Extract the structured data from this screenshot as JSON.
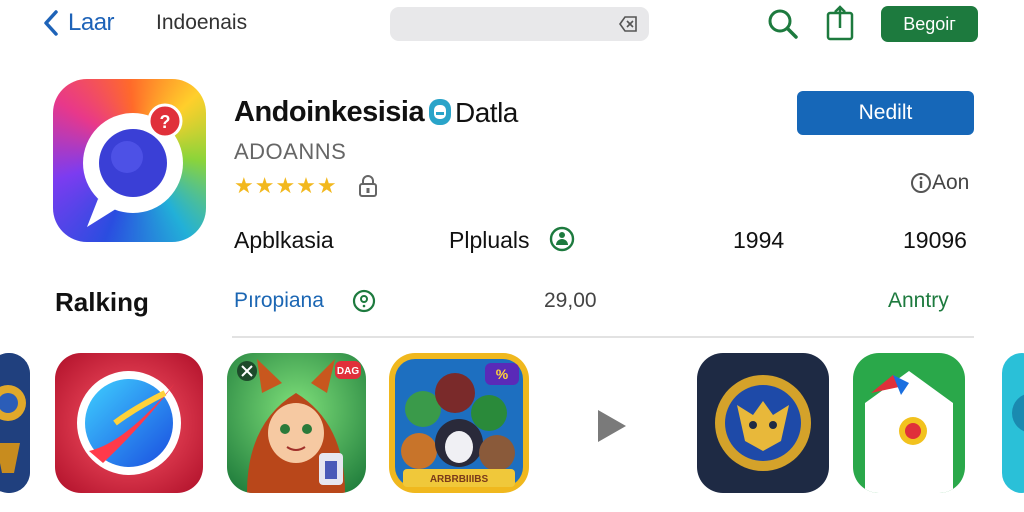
{
  "nav": {
    "back_label": "Laar",
    "breadcrumb": "Indoenais",
    "begin_label": "Begoiг"
  },
  "app": {
    "title": "Andoinkesisia",
    "title_suffix": "Datla",
    "developer": "ADOANNS",
    "stars": "★★★★★",
    "rating": 4.5,
    "install_label": "Nedilt",
    "info_label": "Aon",
    "category": "Apblkasia",
    "popular": "Plpluals",
    "stat_1": "1994",
    "stat_2": "19096"
  },
  "ranking": {
    "title": "Ralking",
    "link": "Pıropiana",
    "count": "29,00",
    "action": "Anntry"
  },
  "colors": {
    "accent_blue": "#1667b8",
    "accent_green": "#1d7a3e",
    "star": "#f2b81e"
  },
  "carousel": {
    "items": [
      {
        "icon": "gold-shield-game-icon"
      },
      {
        "icon": "compass-app-icon"
      },
      {
        "icon": "fox-character-game-icon",
        "badge": "DAG"
      },
      {
        "icon": "heroes-group-game-icon",
        "badge_top": "%",
        "banner": "ARBRBIIIBS"
      },
      {
        "icon": "mask-emblem-game-icon"
      },
      {
        "icon": "map-app-icon"
      },
      {
        "icon": "cyan-game-icon"
      }
    ]
  }
}
